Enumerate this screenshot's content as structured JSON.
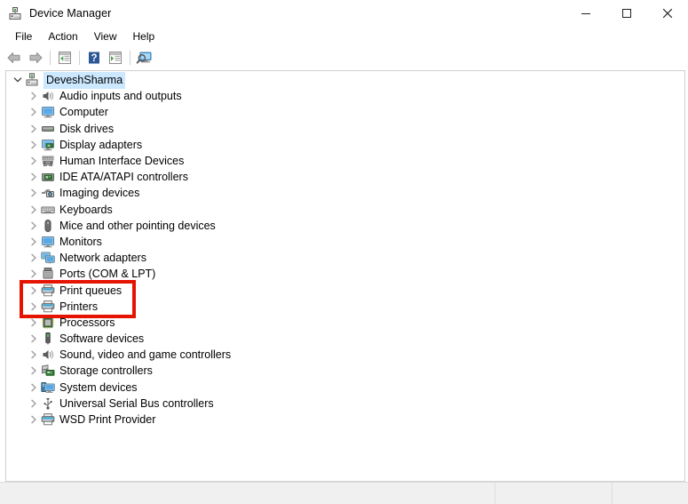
{
  "window": {
    "title": "Device Manager",
    "title_icon": "device-manager-icon",
    "controls": {
      "minimize_label": "Minimize",
      "maximize_label": "Maximize",
      "close_label": "Close"
    }
  },
  "menubar": {
    "items": [
      {
        "label": "File",
        "name": "menu-file"
      },
      {
        "label": "Action",
        "name": "menu-action"
      },
      {
        "label": "View",
        "name": "menu-view"
      },
      {
        "label": "Help",
        "name": "menu-help"
      }
    ]
  },
  "toolbar": {
    "buttons": [
      {
        "icon": "back-arrow-icon",
        "title": "Back"
      },
      {
        "icon": "forward-arrow-icon",
        "title": "Forward"
      },
      {
        "icon": "show-hide-console-tree-icon",
        "title": "Show/Hide Console Tree"
      },
      {
        "icon": "help-question-icon",
        "title": "Help"
      },
      {
        "icon": "properties-icon",
        "title": "Properties"
      },
      {
        "icon": "scan-for-hardware-changes-icon",
        "title": "Scan for hardware changes"
      }
    ]
  },
  "tree": {
    "root": {
      "label": "DeveshSharma",
      "icon": "computer-root-icon",
      "expanded": true,
      "selected": true
    },
    "items": [
      {
        "label": "Audio inputs and outputs",
        "icon": "speaker-icon",
        "name": "tree-item-audio-inputs-and-outputs"
      },
      {
        "label": "Computer",
        "icon": "monitor-icon",
        "name": "tree-item-computer"
      },
      {
        "label": "Disk drives",
        "icon": "disk-drive-icon",
        "name": "tree-item-disk-drives"
      },
      {
        "label": "Display adapters",
        "icon": "display-adapter-icon",
        "name": "tree-item-display-adapters"
      },
      {
        "label": "Human Interface Devices",
        "icon": "gamepad-icon",
        "name": "tree-item-human-interface-devices"
      },
      {
        "label": "IDE ATA/ATAPI controllers",
        "icon": "ide-controller-icon",
        "name": "tree-item-ide-ata-atapi-controllers"
      },
      {
        "label": "Imaging devices",
        "icon": "camera-icon",
        "name": "tree-item-imaging-devices"
      },
      {
        "label": "Keyboards",
        "icon": "keyboard-icon",
        "name": "tree-item-keyboards"
      },
      {
        "label": "Mice and other pointing devices",
        "icon": "mouse-icon",
        "name": "tree-item-mice-and-other-pointing-devices"
      },
      {
        "label": "Monitors",
        "icon": "monitor-icon",
        "name": "tree-item-monitors"
      },
      {
        "label": "Network adapters",
        "icon": "network-adapter-icon",
        "name": "tree-item-network-adapters"
      },
      {
        "label": "Ports (COM & LPT)",
        "icon": "port-icon",
        "name": "tree-item-ports-com-and-lpt"
      },
      {
        "label": "Print queues",
        "icon": "printer-icon",
        "name": "tree-item-print-queues",
        "highlighted": true
      },
      {
        "label": "Printers",
        "icon": "printer-icon",
        "name": "tree-item-printers",
        "highlighted": true
      },
      {
        "label": "Processors",
        "icon": "processor-icon",
        "name": "tree-item-processors"
      },
      {
        "label": "Software devices",
        "icon": "software-device-icon",
        "name": "tree-item-software-devices"
      },
      {
        "label": "Sound, video and game controllers",
        "icon": "speaker-icon",
        "name": "tree-item-sound-video-and-game-controllers"
      },
      {
        "label": "Storage controllers",
        "icon": "storage-controller-icon",
        "name": "tree-item-storage-controllers"
      },
      {
        "label": "System devices",
        "icon": "system-device-icon",
        "name": "tree-item-system-devices"
      },
      {
        "label": "Universal Serial Bus controllers",
        "icon": "usb-icon",
        "name": "tree-item-universal-serial-bus-controllers"
      },
      {
        "label": "WSD Print Provider",
        "icon": "printer-icon",
        "name": "tree-item-wsd-print-provider"
      }
    ]
  },
  "annotation": {
    "highlight_color": "#e51400",
    "highlight_targets": [
      "Print queues",
      "Printers"
    ]
  },
  "statusbar": {
    "panes": [
      "",
      "",
      ""
    ]
  }
}
